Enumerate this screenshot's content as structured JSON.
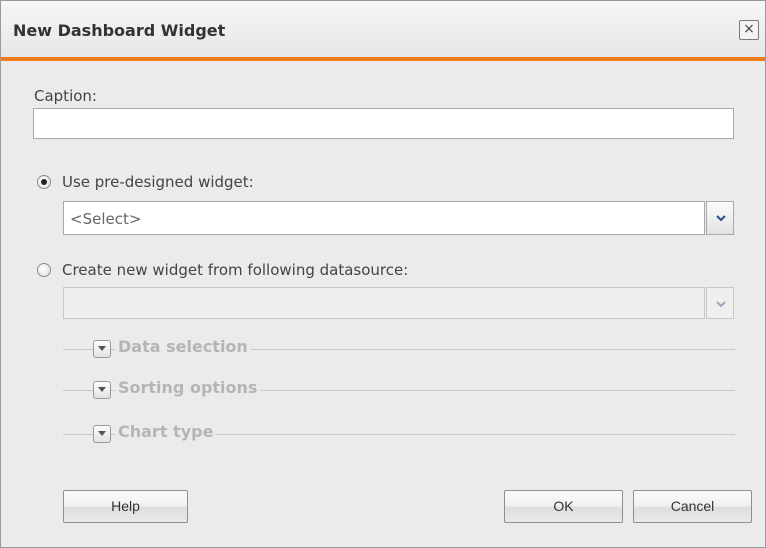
{
  "dialog": {
    "title": "New Dashboard Widget",
    "close_symbol": "×"
  },
  "caption": {
    "label": "Caption:",
    "value": ""
  },
  "option_predesigned": {
    "label": "Use pre-designed widget:",
    "selected": true,
    "select_value": "<Select>"
  },
  "option_datasource": {
    "label": "Create new widget from following datasource:",
    "selected": false,
    "select_value": ""
  },
  "sections": [
    {
      "title": "Data selection"
    },
    {
      "title": "Sorting options"
    },
    {
      "title": "Chart type"
    }
  ],
  "buttons": {
    "help": "Help",
    "ok": "OK",
    "cancel": "Cancel"
  },
  "colors": {
    "accent": "#f07c1c",
    "background": "#ebebeb"
  },
  "icons": {
    "close": "close-icon",
    "dropdown": "chevron-down-icon",
    "section_toggle": "expand-toggle-icon"
  }
}
